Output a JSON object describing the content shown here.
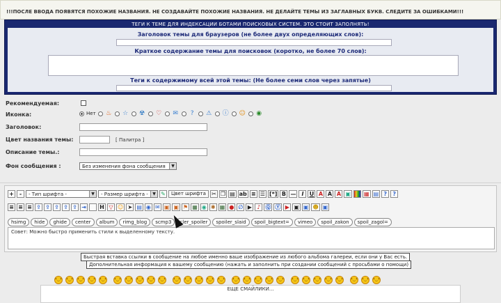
{
  "warning": "!!!ПОСЛЕ ВВОДА ПОЯВЯТСЯ ПОХОЖИЕ НАЗВАНИЯ. НЕ СОЗДАВАЙТЕ ПОХОЖИЕ НАЗВАНИЯ. НЕ ДЕЛАЙТЕ ТЕМЫ ИЗ ЗАГЛАВНЫХ БУКВ. СЛЕДИТЕ ЗА ОШИБКАМИ!!!",
  "seo": {
    "header": "ТЕГИ К ТЕМЕ ДЛЯ ИНДЕКСАЦИИ БОТАМИ ПОИСКОВЫХ СИСТЕМ. ЭТО СТОИТ ЗАПОЛНЯТЬ!",
    "title_label": "Заголовок темы для браузеров (не более двух определяющих слов):",
    "desc_label": "Краткое содержание темы для поисковок (коротко, не более 70 слов):",
    "tags_label": "Теги к содержимому всей этой темы: (Не более семи слов через запятые)"
  },
  "form": {
    "recommended_label": "Рекомендуемая:",
    "icon_label": "Иконка:",
    "icon_none": "Нет",
    "icons": [
      "fire-icon",
      "star-icon",
      "radiation-icon",
      "heart-icon",
      "speech-bubble-icon",
      "question-icon",
      "warning-icon",
      "info-icon",
      "smile-icon",
      "globe-icon"
    ],
    "title_label": "Заголовок:",
    "title_color_label": "Цвет названия темы:",
    "palette_link": "[ Палитра ]",
    "description_label": "Описание темы.:",
    "background_label": "Фон сообщения :",
    "background_value": "Без изменения фона сообщения"
  },
  "editor": {
    "plus": "+",
    "minus": "-",
    "font_type": "- Тип шрифта -",
    "font_size": "- Размер шрифта -",
    "font_color_button": "Цвет шрифта",
    "text_buttons": [
      "ab",
      "[*]",
      "B",
      "—",
      "I",
      "U"
    ],
    "row2_letters": [
      "H"
    ],
    "tags": [
      "hsimg",
      "hide",
      "ghide",
      "center",
      "album",
      "rimg_blog",
      "scmp3",
      "cler_spoiler",
      "spoiler_slaid",
      "spoil_bigtext=",
      "vimeo",
      "spoil_zakon",
      "spoil_zagol="
    ],
    "hint": "Совет: Можно быстро применить стили к выделенному тексту."
  },
  "tips": {
    "album": "Быстрая вставка ссылки в сообщение на любое именно ваше изображение из любого альбома галереи, если они у Вас есть.",
    "extra": "Дополнительная информация к вашему сообщению (нажать и заполнить при создании сообщений с просьбами о помощи)"
  },
  "smilies": {
    "count": 28,
    "more_label": "ЕЩЕ СМАЙЛИКИ..."
  }
}
